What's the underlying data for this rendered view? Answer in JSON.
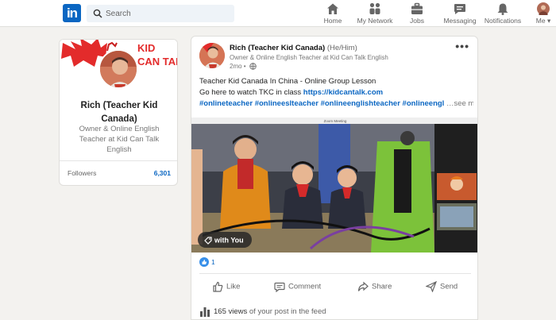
{
  "nav": {
    "logo": "in",
    "search_placeholder": "Search",
    "items": [
      {
        "label": "Home",
        "icon": "home-icon"
      },
      {
        "label": "My Network",
        "icon": "network-icon"
      },
      {
        "label": "Jobs",
        "icon": "briefcase-icon"
      },
      {
        "label": "Messaging",
        "icon": "messaging-icon"
      },
      {
        "label": "Notifications",
        "icon": "bell-icon"
      },
      {
        "label": "Me",
        "icon": "avatar"
      }
    ]
  },
  "profile": {
    "name": "Rich (Teacher Kid Canada)",
    "headline": "Owner & Online English Teacher at Kid Can Talk English",
    "banner_text": "KID CAN TALK",
    "stat": {
      "label": "Followers",
      "value": "6,301"
    }
  },
  "post": {
    "author": "Rich (Teacher Kid Canada)",
    "pronouns": "(He/Him)",
    "subtitle": "Owner & Online English Teacher at Kid Can Talk English",
    "time": "2mo •",
    "text_line1": "Teacher Kid Canada In China - Online Group Lesson",
    "text_line2_prefix": "Go here to watch TKC in class ",
    "text_line2_link": "https://kidcantalk.com",
    "hashtags": "#onlineteacher #onlineeslteacher #onlineenglishteacher #onlineengl",
    "see_more": "…see more",
    "video_window_title": "Zoom Meeting",
    "video_badge": "with You",
    "reaction_count": "1",
    "actions": {
      "like": "Like",
      "comment": "Comment",
      "share": "Share",
      "send": "Send"
    },
    "views_count": "165 views",
    "views_suffix": " of your post in the feed"
  },
  "colors": {
    "accent": "#0a66c2",
    "page_bg": "#f3f2ef",
    "banner_red": "#e32b2b"
  }
}
